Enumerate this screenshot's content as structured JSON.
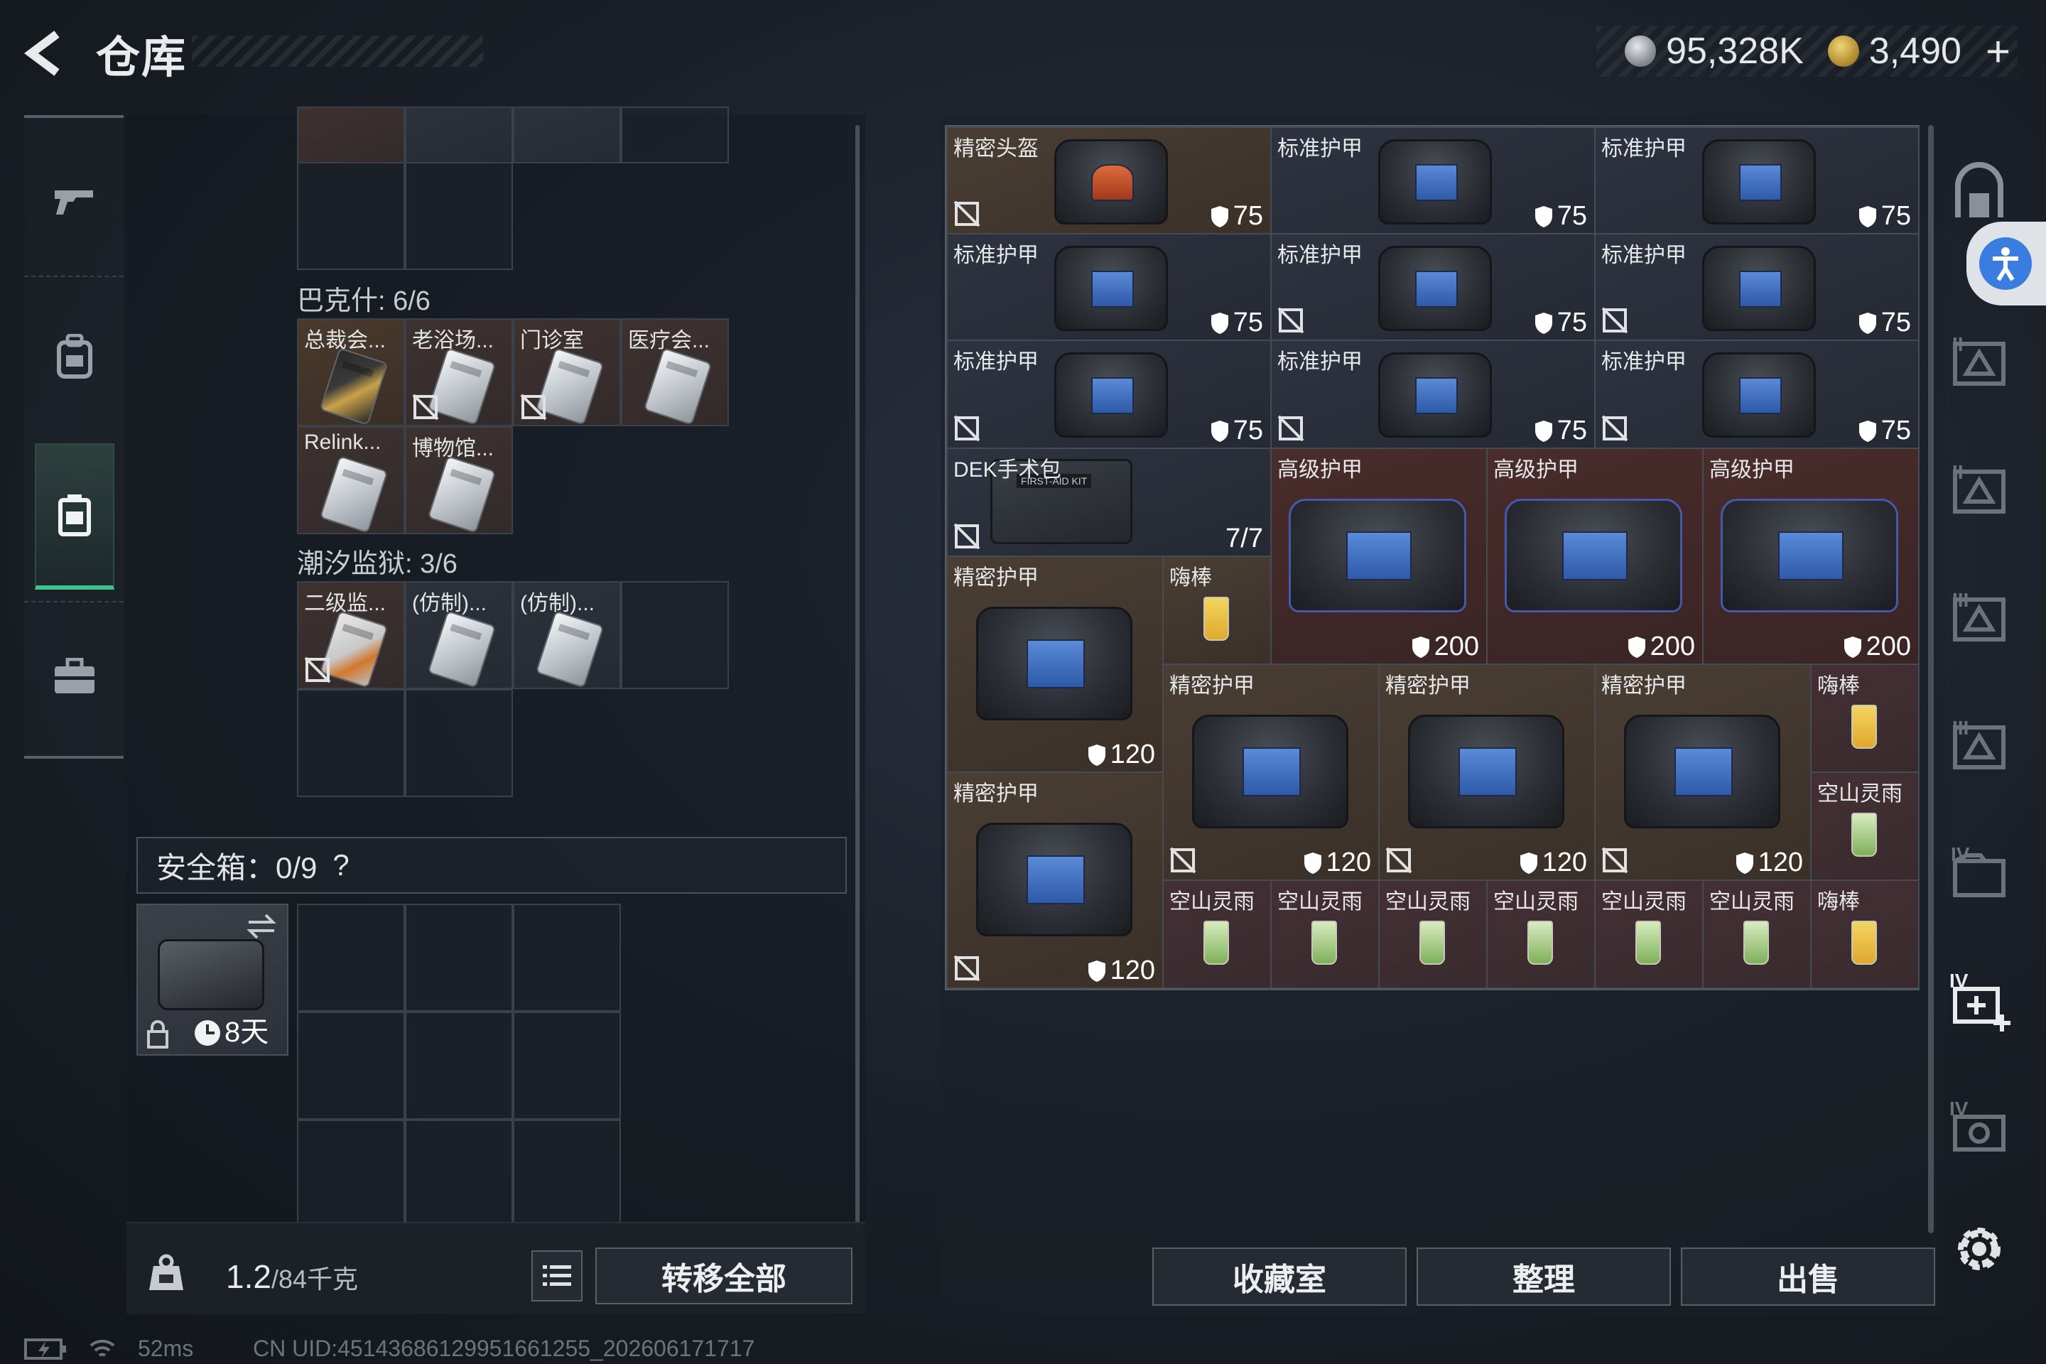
{
  "header": {
    "title": "仓库",
    "currency": [
      {
        "name": "silver-coin",
        "value": "95,328K"
      },
      {
        "name": "gold-coin",
        "value": "3,490"
      }
    ],
    "plus": "+"
  },
  "left_nav": {
    "items": [
      {
        "name": "weapon-icon"
      },
      {
        "name": "backpack-icon"
      },
      {
        "name": "vest-icon",
        "active": true
      },
      {
        "name": "briefcase-icon"
      }
    ]
  },
  "key_sections": [
    {
      "label": "巴克什: 6/6"
    },
    {
      "label": "潮汐监狱: 3/6"
    }
  ],
  "key_cards_bakeshi": [
    "总裁会...",
    "老浴场...",
    "门诊室",
    "医疗会...",
    "Relink...",
    "博物馆..."
  ],
  "key_cards_prison": [
    "二级监...",
    "(仿制)...",
    "(仿制)..."
  ],
  "safe": {
    "label": "安全箱：0/9",
    "help": "?",
    "days": "8天"
  },
  "weight": {
    "value": "1.2",
    "cap": "/84千克"
  },
  "buttons": {
    "transfer_all": "转移全部",
    "collection": "收藏室",
    "organize": "整理",
    "sell": "出售"
  },
  "stash_items": [
    {
      "label": "精密头盔",
      "dur": "75"
    },
    {
      "label": "标准护甲",
      "dur": "75"
    },
    {
      "label": "标准护甲",
      "dur": "75"
    },
    {
      "label": "标准护甲",
      "dur": "75"
    },
    {
      "label": "标准护甲",
      "dur": "75"
    },
    {
      "label": "标准护甲",
      "dur": "75"
    },
    {
      "label": "标准护甲",
      "dur": "75"
    },
    {
      "label": "标准护甲",
      "dur": "75"
    },
    {
      "label": "标准护甲",
      "dur": "75"
    },
    {
      "label": "DEK手术包",
      "dur": "7/7"
    },
    {
      "label": "高级护甲",
      "dur": "200"
    },
    {
      "label": "高级护甲",
      "dur": "200"
    },
    {
      "label": "高级护甲",
      "dur": "200"
    },
    {
      "label": "精密护甲",
      "dur": "120"
    },
    {
      "label": "嗨棒",
      "dur": ""
    },
    {
      "label": "精密护甲",
      "dur": "120"
    },
    {
      "label": "精密护甲",
      "dur": "120"
    },
    {
      "label": "精密护甲",
      "dur": "120"
    },
    {
      "label": "嗨棒",
      "dur": ""
    },
    {
      "label": "空山灵雨",
      "dur": ""
    },
    {
      "label": "精密护甲",
      "dur": "120"
    },
    {
      "label": "空山灵雨",
      "dur": ""
    },
    {
      "label": "空山灵雨",
      "dur": ""
    },
    {
      "label": "空山灵雨",
      "dur": ""
    },
    {
      "label": "空山灵雨",
      "dur": ""
    },
    {
      "label": "空山灵雨",
      "dur": ""
    },
    {
      "label": "空山灵雨",
      "dur": ""
    },
    {
      "label": "嗨棒",
      "dur": ""
    }
  ],
  "side_icons": [
    "locker-icon",
    "stash-tab-2-icon",
    "stash-tab-3-icon",
    "stash-tab-4-icon",
    "stash-tab-5-icon",
    "stash-tab-iv-icon",
    "add-stash-icon",
    "stash-tab-camera-icon"
  ],
  "status": {
    "ping": "52ms",
    "uid": "CN UID:45143686129951661255_202606171717"
  },
  "colors": {
    "accent_green": "#3ec48a",
    "accessibility_blue": "#3a7ce0"
  }
}
